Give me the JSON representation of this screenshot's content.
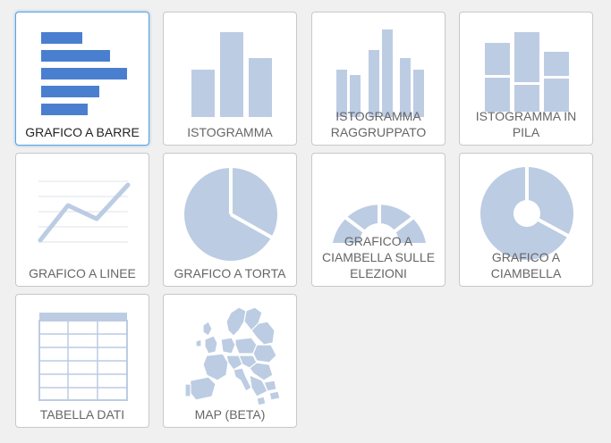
{
  "colors": {
    "accent": "#5aa3e0",
    "icon_selected": "#4a7fd0",
    "icon": "#bccce3",
    "tile_border": "#c8c8c8",
    "background": "#f0f0f0"
  },
  "tiles": [
    {
      "label": "GRAFICO A BARRE",
      "icon": "horizontal-bar-chart-icon",
      "selected": true
    },
    {
      "label": "ISTOGRAMMA",
      "icon": "column-chart-icon",
      "selected": false
    },
    {
      "label": "ISTOGRAMMA\nRAGGRUPPATO",
      "icon": "grouped-column-chart-icon",
      "selected": false
    },
    {
      "label": "ISTOGRAMMA IN\nPILA",
      "icon": "stacked-column-chart-icon",
      "selected": false
    },
    {
      "label": "GRAFICO A LINEE",
      "icon": "line-chart-icon",
      "selected": false
    },
    {
      "label": "GRAFICO A TORTA",
      "icon": "pie-chart-icon",
      "selected": false
    },
    {
      "label": "GRAFICO A\nCIAMBELLA SULLE\nELEZIONI",
      "icon": "election-donut-chart-icon",
      "selected": false
    },
    {
      "label": "GRAFICO A\nCIAMBELLA",
      "icon": "donut-chart-icon",
      "selected": false
    },
    {
      "label": "TABELLA DATI",
      "icon": "data-table-icon",
      "selected": false
    },
    {
      "label": "MAP (BETA)",
      "icon": "europe-map-icon",
      "selected": false
    }
  ]
}
